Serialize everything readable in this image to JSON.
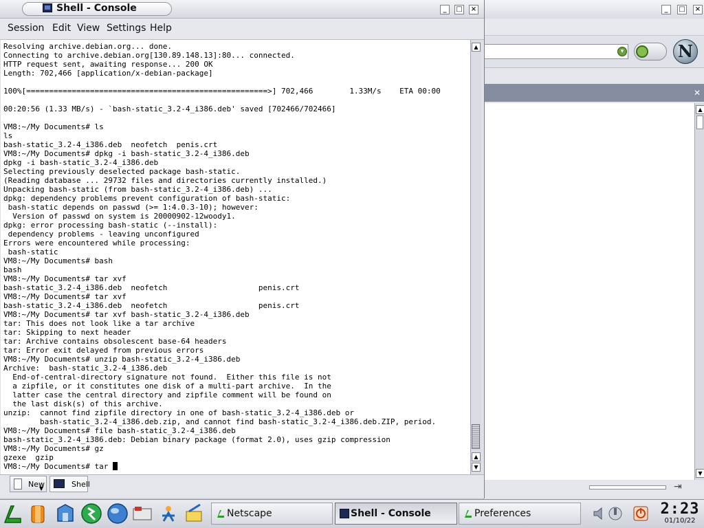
{
  "konsole": {
    "title": "Shell - Console",
    "menu": [
      "Session",
      "Edit",
      "View",
      "Settings",
      "Help"
    ],
    "terminal_lines": [
      "Resolving archive.debian.org... done.",
      "Connecting to archive.debian.org[130.89.148.13]:80... connected.",
      "HTTP request sent, awaiting response... 200 OK",
      "Length: 702,466 [application/x-debian-package]",
      "",
      "100%[=====================================================>] 702,466        1.33M/s    ETA 00:00",
      "",
      "00:20:56 (1.33 MB/s) - `bash-static_3.2-4_i386.deb' saved [702466/702466]",
      "",
      "VM8:~/My Documents# ls",
      "ls",
      "bash-static_3.2-4_i386.deb  neofetch  penis.crt",
      "VM8:~/My Documents# dpkg -i bash-static_3.2-4_i386.deb",
      "dpkg -i bash-static_3.2-4_i386.deb",
      "Selecting previously deselected package bash-static.",
      "(Reading database ... 29732 files and directories currently installed.)",
      "Unpacking bash-static (from bash-static_3.2-4_i386.deb) ...",
      "dpkg: dependency problems prevent configuration of bash-static:",
      " bash-static depends on passwd (>= 1:4.0.3-10); however:",
      "  Version of passwd on system is 20000902-12woody1.",
      "dpkg: error processing bash-static (--install):",
      " dependency problems - leaving unconfigured",
      "Errors were encountered while processing:",
      " bash-static",
      "VM8:~/My Documents# bash",
      "bash",
      "VM8:~/My Documents# tar xvf",
      "bash-static_3.2-4_i386.deb  neofetch                    penis.crt",
      "VM8:~/My Documents# tar xvf",
      "bash-static_3.2-4_i386.deb  neofetch                    penis.crt",
      "VM8:~/My Documents# tar xvf bash-static_3.2-4_i386.deb",
      "tar: This does not look like a tar archive",
      "tar: Skipping to next header",
      "tar: Archive contains obsolescent base-64 headers",
      "tar: Error exit delayed from previous errors",
      "VM8:~/My Documents# unzip bash-static_3.2-4_i386.deb",
      "Archive:  bash-static_3.2-4_i386.deb",
      "  End-of-central-directory signature not found.  Either this file is not",
      "  a zipfile, or it constitutes one disk of a multi-part archive.  In the",
      "  latter case the central directory and zipfile comment will be found on",
      "  the last disk(s) of this archive.",
      "unzip:  cannot find zipfile directory in one of bash-static_3.2-4_i386.deb or",
      "        bash-static_3.2-4_i386.deb.zip, and cannot find bash-static_3.2-4_i386.deb.ZIP, period.",
      "VM8:~/My Documents# file bash-static_3.2-4_i386.deb",
      "bash-static_3.2-4_i386.deb: Debian binary package (format 2.0), uses gzip compression",
      "VM8:~/My Documents# gz",
      "gzexe  gzip"
    ],
    "prompt_line": "VM8:~/My Documents# tar ",
    "session_tabs": [
      "New",
      "Shell"
    ]
  },
  "netscape": {
    "logo_letter": "N"
  },
  "taskbar": {
    "launchers": [
      "kde-menu-icon",
      "lifesaver-help-icon",
      "home-folder-icon",
      "konqueror-icon",
      "web-browser-icon",
      "mail-icon",
      "java-icon",
      "office-icon"
    ],
    "tasks": [
      {
        "label": "Netscape",
        "active": false
      },
      {
        "label": "Shell - Console",
        "active": true
      },
      {
        "label": "Preferences",
        "active": false
      }
    ],
    "clock_time": "2:23",
    "clock_date": "01/10/22"
  },
  "colors": {
    "panel": "#d9dce3",
    "terminal_bg": "#ffffff",
    "ns_tabbar": "#848da0",
    "accent_green": "#2a9d2a"
  }
}
